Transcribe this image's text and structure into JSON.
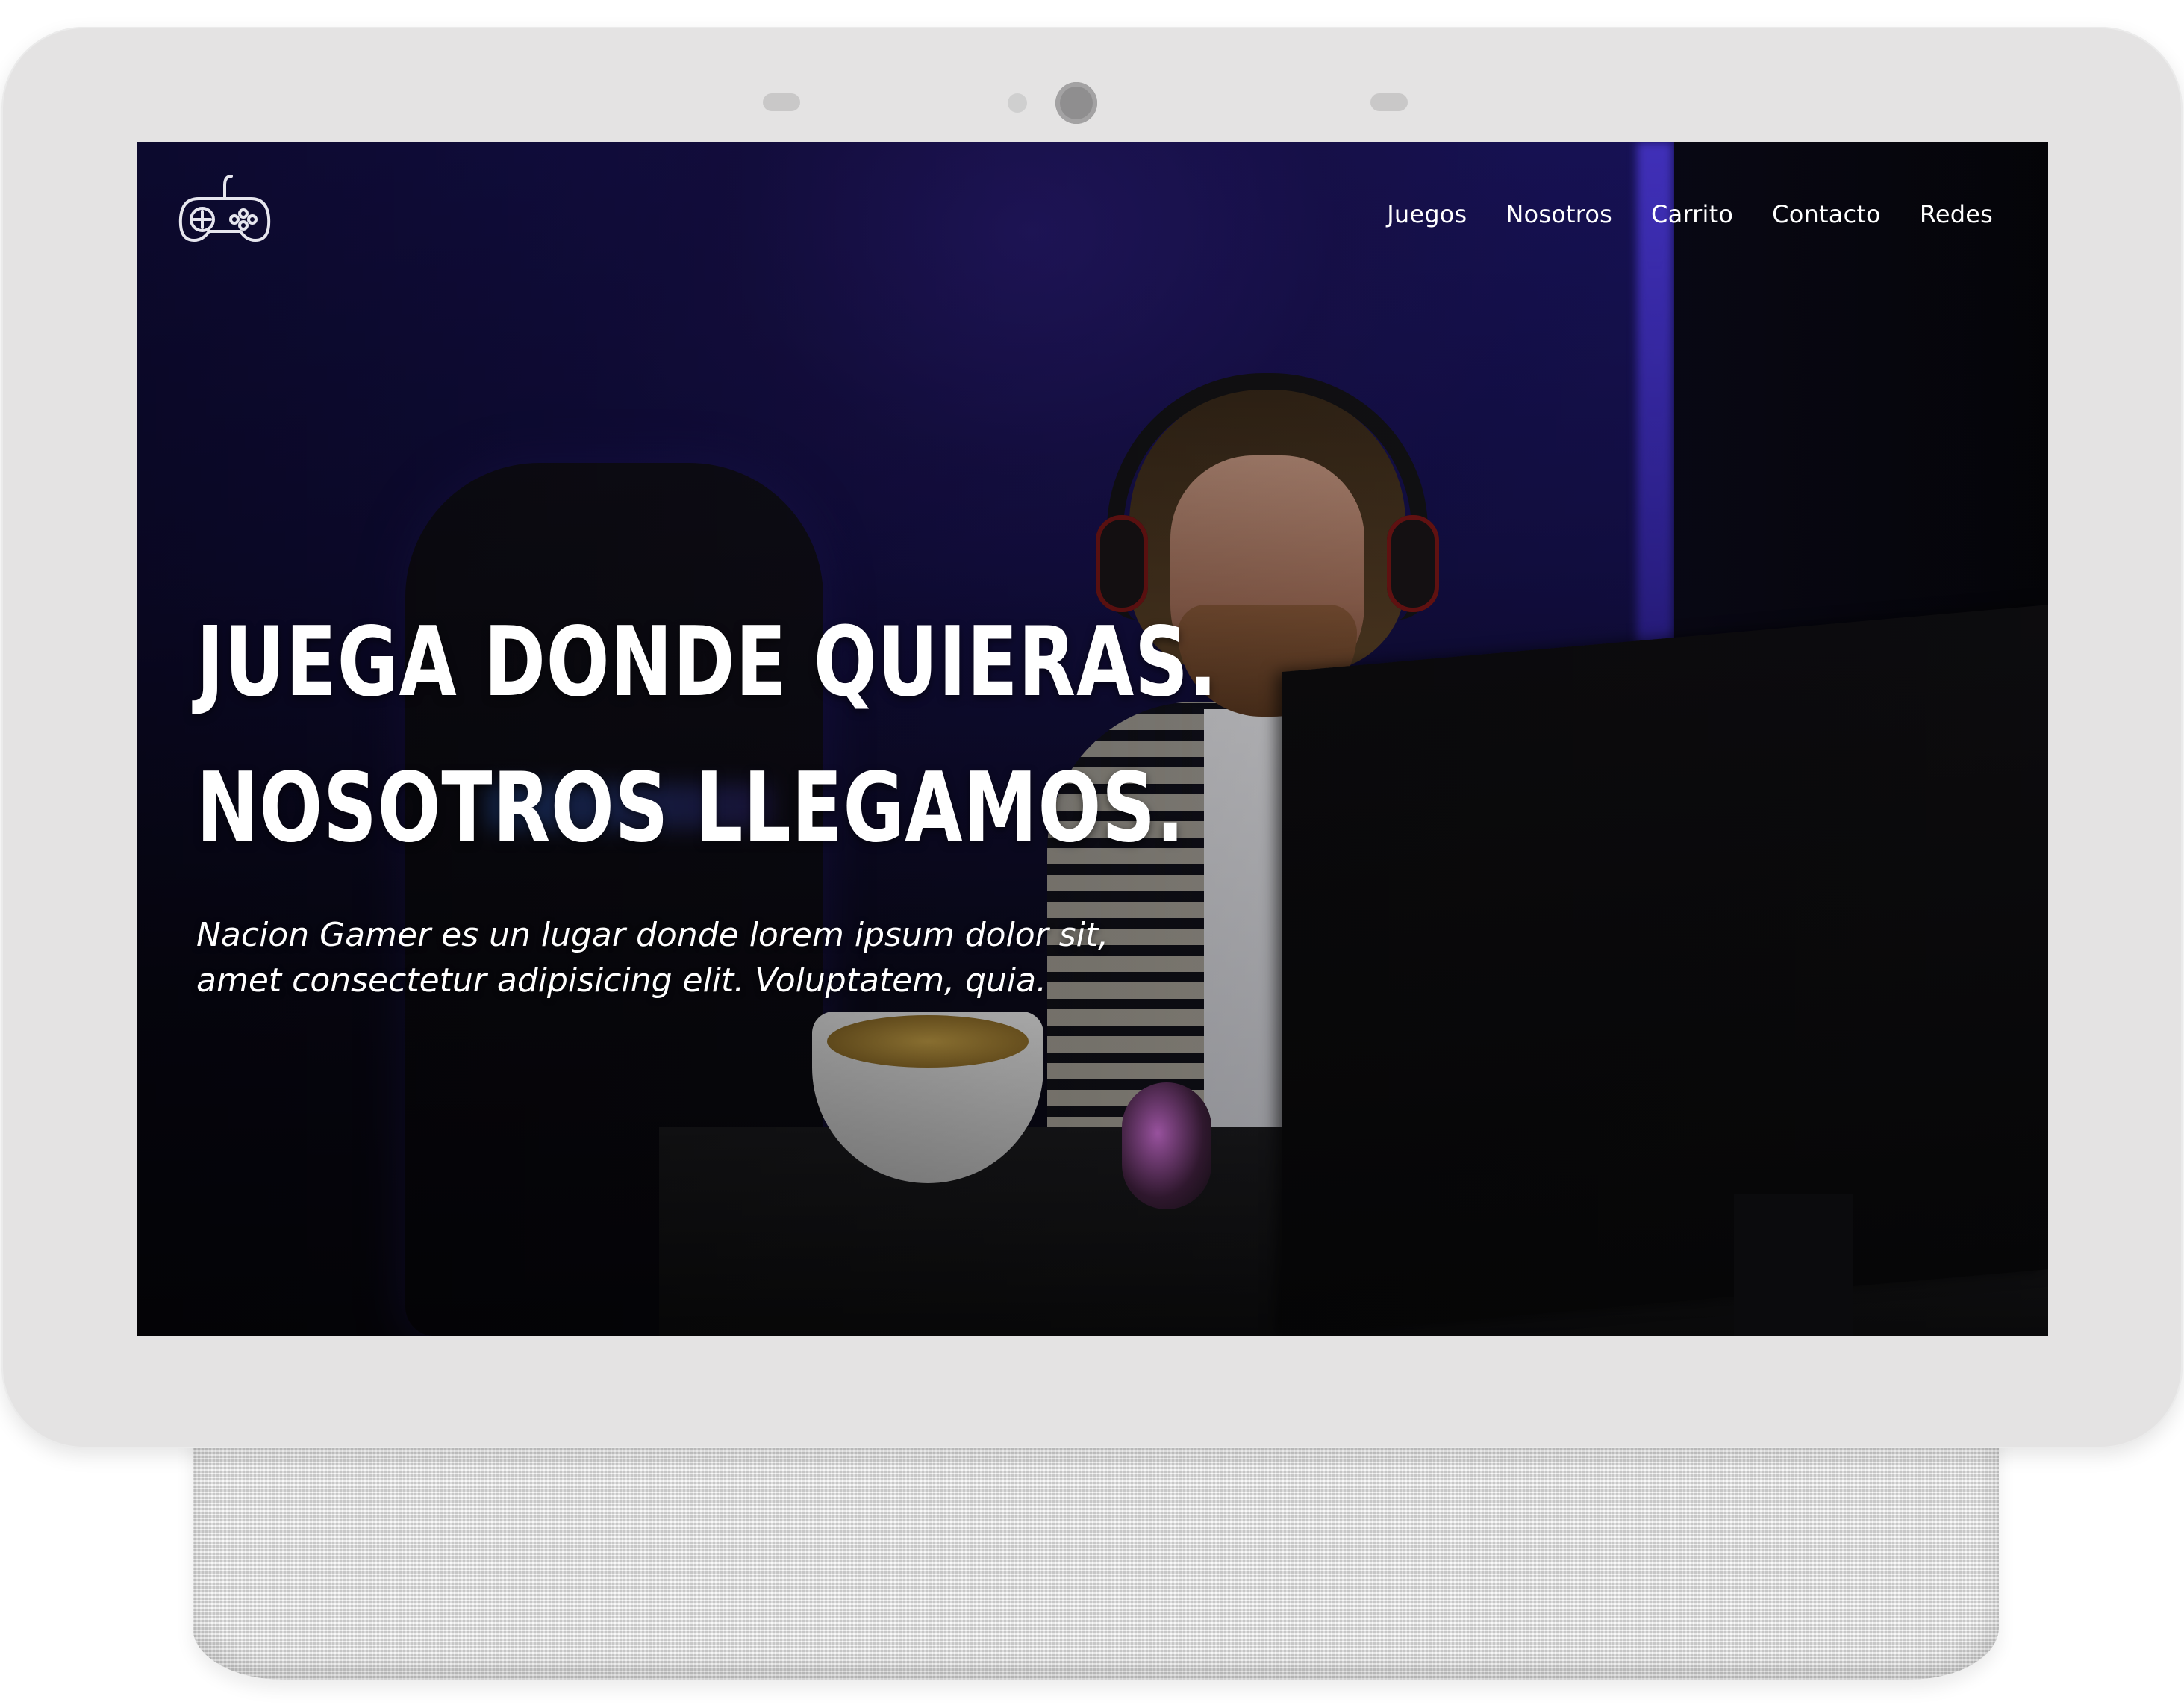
{
  "nav": {
    "logo_icon": "gamepad-icon",
    "links": [
      "Juegos",
      "Nosotros",
      "Carrito",
      "Contacto",
      "Redes"
    ]
  },
  "hero": {
    "title_line1": "JUEGA DONDE QUIERAS.",
    "title_line2": "NOSOTROS LLEGAMOS.",
    "subtitle": "Nacion Gamer es un lugar donde lorem ipsum dolor sit, amet consectetur adipisicing elit. Voluptatem, quia."
  },
  "colors": {
    "accent": "#2a1c78",
    "text": "#ffffff",
    "device_bezel": "#e4e3e3"
  }
}
